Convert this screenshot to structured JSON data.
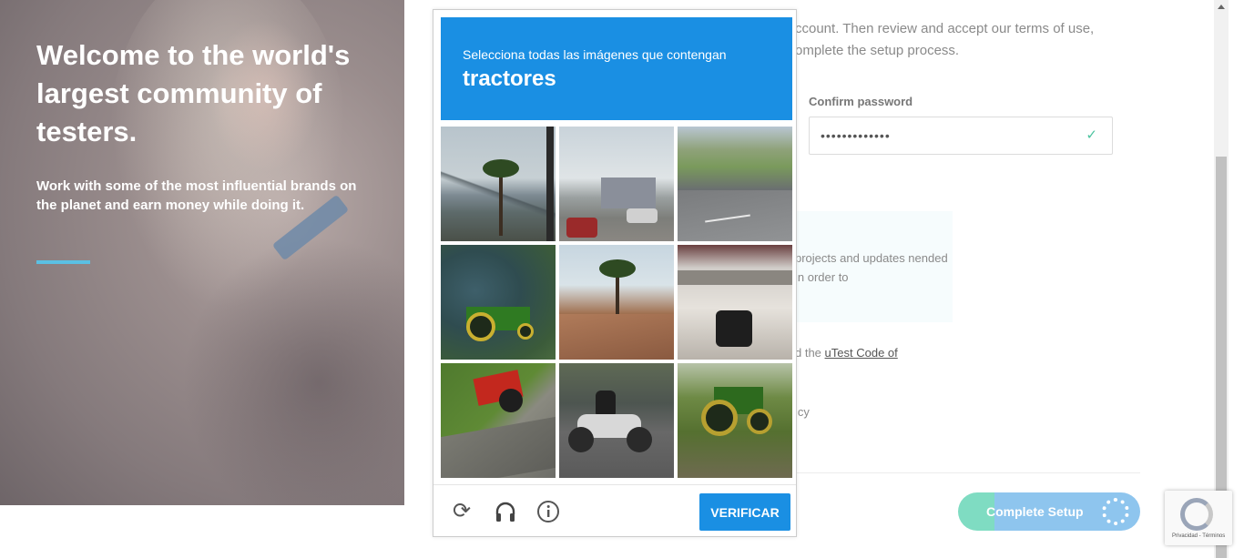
{
  "hero": {
    "title": "Welcome to the world's largest community of testers.",
    "subtitle": "Work with some of the most influential brands on the planet and earn money while doing it."
  },
  "form": {
    "intro_text": "ccount. Then review and accept our terms of use, omplete the setup process.",
    "confirm_password_label": "Confirm password",
    "confirm_password_value": "•••••••••••••",
    "notice_text": "projects and updates nended in order to",
    "code_prefix": "d the ",
    "code_link": "uTest Code of",
    "policy_text": "icy",
    "complete_setup_label": "Complete Setup"
  },
  "captcha": {
    "instruction": "Selecciona todas las imágenes que contengan",
    "keyword": "tractores",
    "verify_label": "VERIFICAR",
    "tiles": [
      "bridge-palm-tile",
      "street-tile",
      "road-tile",
      "green-tractor-tile",
      "rooftop-palm-tile",
      "trailer-tile",
      "red-tractor-tile",
      "motorcycle-tile",
      "green-tractor-field-tile"
    ]
  },
  "recaptcha_badge": {
    "footer": "Privacidad - Términos"
  },
  "colors": {
    "accent_blue": "#1a8fe3",
    "hero_rule": "#5bc0e3",
    "setup_green": "#7fdcc2",
    "setup_blue": "#8ec5ee"
  }
}
